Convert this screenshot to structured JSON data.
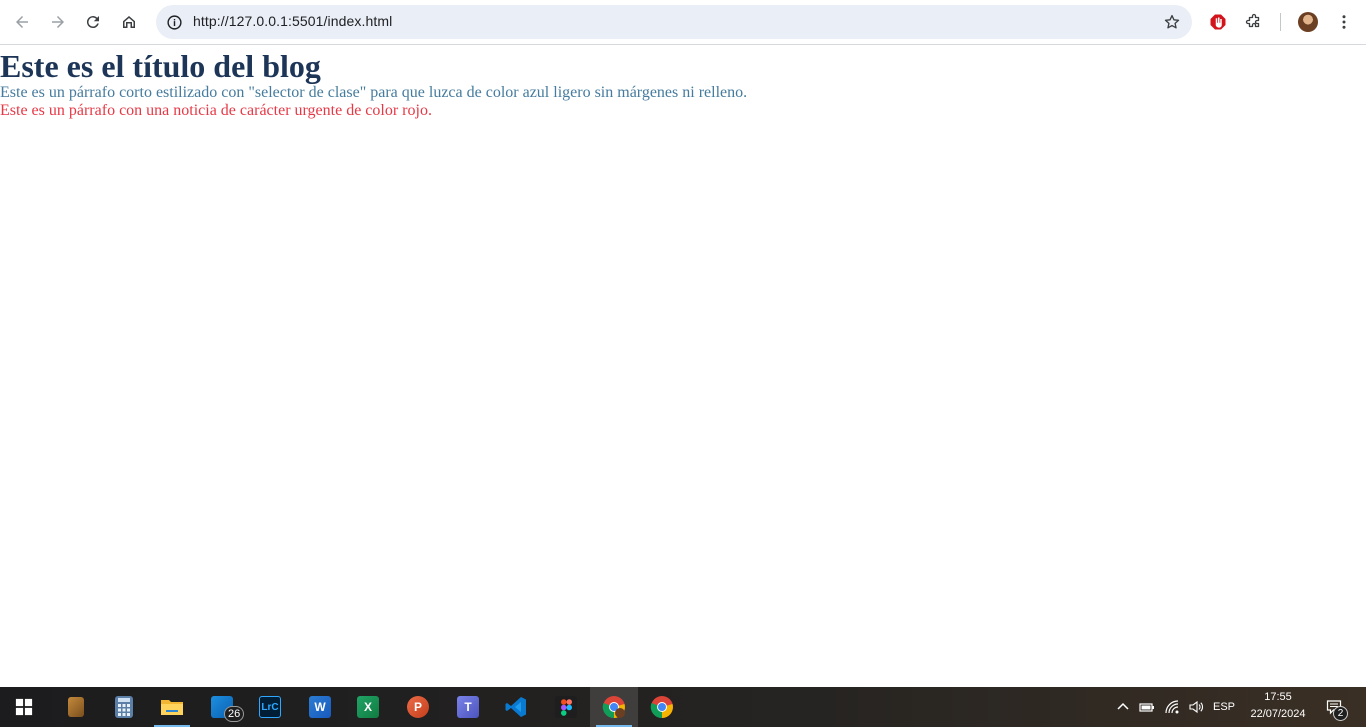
{
  "browser": {
    "url": "http://127.0.0.1:5501/index.html"
  },
  "page": {
    "title": "Este es el título del blog",
    "paragraph_blue": "Este es un párrafo corto estilizado con \"selector de clase\" para que luzca de color azul ligero sin márgenes ni relleno.",
    "paragraph_red": "Este es un párrafo con una noticia de carácter urgente de color rojo."
  },
  "colors": {
    "title": "#1d3557",
    "paragraph_blue": "#457b9d",
    "paragraph_red": "#e63946"
  },
  "taskbar": {
    "apps": [
      {
        "name": "file-manager-icon"
      },
      {
        "name": "calculator-icon"
      },
      {
        "name": "file-explorer-icon"
      },
      {
        "name": "mail-icon",
        "badge": "26"
      },
      {
        "name": "lightroom-classic-icon",
        "label": "LrC"
      },
      {
        "name": "word-icon",
        "label": "W"
      },
      {
        "name": "excel-icon",
        "label": "X"
      },
      {
        "name": "powerpoint-icon",
        "label": "P"
      },
      {
        "name": "teams-icon",
        "label": "T"
      },
      {
        "name": "vscode-icon"
      },
      {
        "name": "figma-icon"
      },
      {
        "name": "chrome-profile-icon",
        "active": true
      },
      {
        "name": "chrome-icon"
      }
    ],
    "language": "ESP",
    "time": "17:55",
    "date": "22/07/2024",
    "notifications": "2"
  }
}
